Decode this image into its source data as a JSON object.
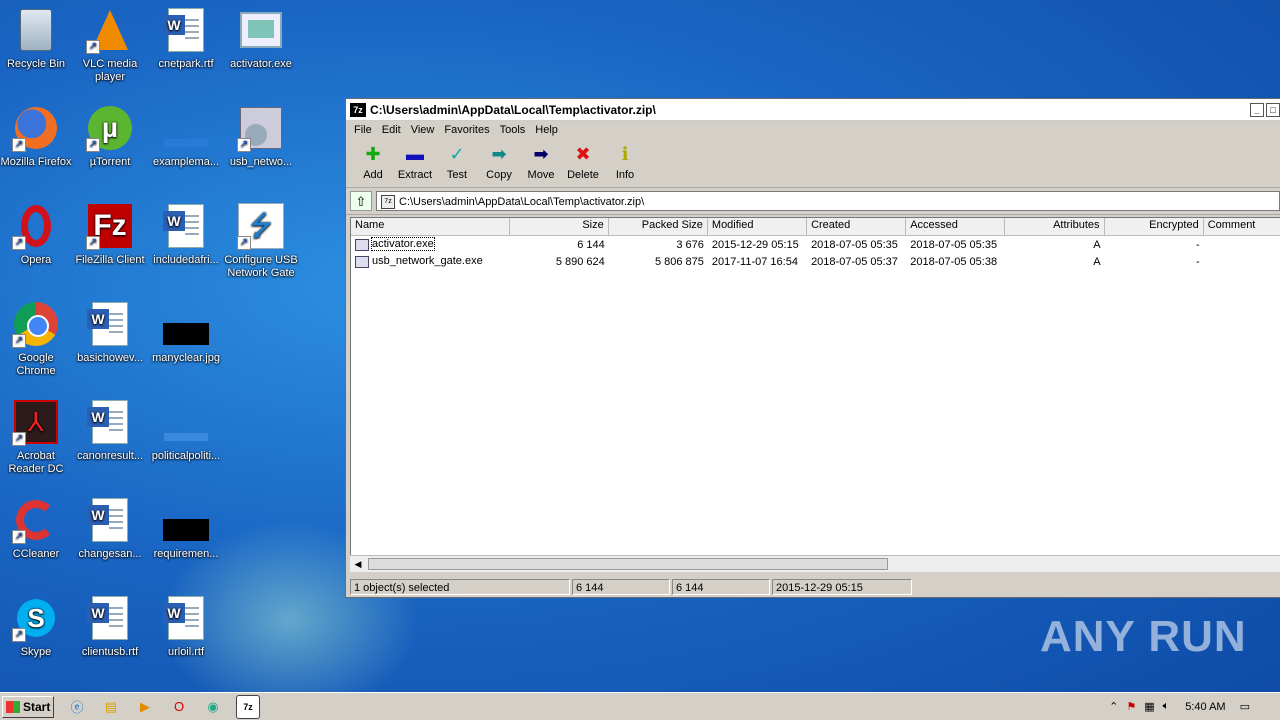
{
  "desktop": {
    "icons": [
      {
        "label": "Recycle Bin"
      },
      {
        "label": "VLC media player"
      },
      {
        "label": "cnetpark.rtf"
      },
      {
        "label": "activator.exe"
      },
      {
        "label": "Mozilla Firefox"
      },
      {
        "label": "µTorrent"
      },
      {
        "label": "examplema..."
      },
      {
        "label": "usb_netwo..."
      },
      {
        "label": "Opera"
      },
      {
        "label": "FileZilla Client"
      },
      {
        "label": "includedafri..."
      },
      {
        "label": "Configure USB Network Gate"
      },
      {
        "label": "Google Chrome"
      },
      {
        "label": "basichowev..."
      },
      {
        "label": "manyclear.jpg"
      },
      {
        "label": "Acrobat Reader DC"
      },
      {
        "label": "canonresult..."
      },
      {
        "label": "politicalpoliti..."
      },
      {
        "label": "CCleaner"
      },
      {
        "label": "changesan..."
      },
      {
        "label": "requiremen..."
      },
      {
        "label": "Skype"
      },
      {
        "label": "clientusb.rtf"
      },
      {
        "label": "urloil.rtf"
      }
    ]
  },
  "window": {
    "title": "C:\\Users\\admin\\AppData\\Local\\Temp\\activator.zip\\",
    "app_badge": "7z",
    "menu": [
      "File",
      "Edit",
      "View",
      "Favorites",
      "Tools",
      "Help"
    ],
    "toolbar": {
      "add": "Add",
      "extract": "Extract",
      "test": "Test",
      "copy": "Copy",
      "move": "Move",
      "delete": "Delete",
      "info": "Info"
    },
    "address": "C:\\Users\\admin\\AppData\\Local\\Temp\\activator.zip\\",
    "columns": [
      "Name",
      "Size",
      "Packed Size",
      "Modified",
      "Created",
      "Accessed",
      "Attributes",
      "Encrypted",
      "Comment"
    ],
    "rows": [
      {
        "name": "activator.exe",
        "size": "6 144",
        "packed": "3 676",
        "modified": "2015-12-29 05:15",
        "created": "2018-07-05 05:35",
        "accessed": "2018-07-05 05:35",
        "attributes": "A",
        "encrypted": "-",
        "comment": ""
      },
      {
        "name": "usb_network_gate.exe",
        "size": "5 890 624",
        "packed": "5 806 875",
        "modified": "2017-11-07 16:54",
        "created": "2018-07-05 05:37",
        "accessed": "2018-07-05 05:38",
        "attributes": "A",
        "encrypted": "-",
        "comment": ""
      }
    ],
    "status": {
      "selected": "1 object(s) selected",
      "size": "6 144",
      "packed": "6 144",
      "date": "2015-12-29 05:15"
    }
  },
  "taskbar": {
    "start_label": "Start",
    "clock": "5:40 AM"
  },
  "watermark": "ANY RUN"
}
